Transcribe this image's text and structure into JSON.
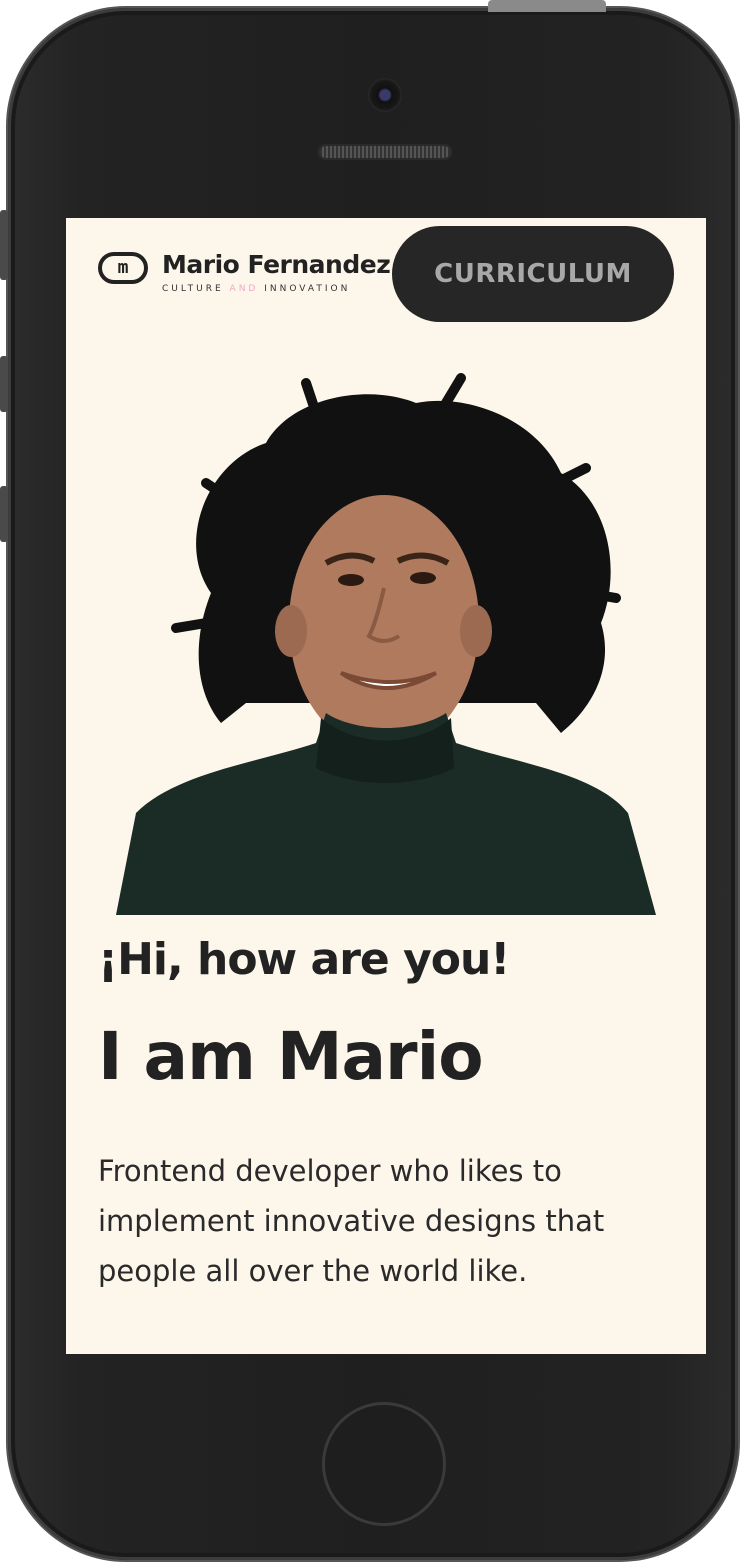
{
  "header": {
    "logo_mark": "m",
    "logo_name": "Mario Fernandez",
    "tagline_part1": "CULTURE",
    "tagline_accent": "AND",
    "tagline_part2": "INNOVATION",
    "cta_label": "CURRICULUM"
  },
  "hero": {
    "greeting": "¡Hi, how are you!",
    "name": "I am Mario",
    "description": "Frontend developer who likes to implement innovative designs that people all over the world like."
  },
  "colors": {
    "background": "#fdf6ea",
    "text": "#222222",
    "button": "#262626",
    "button_text": "#a8a8a8",
    "accent": "#f0a8c4"
  }
}
